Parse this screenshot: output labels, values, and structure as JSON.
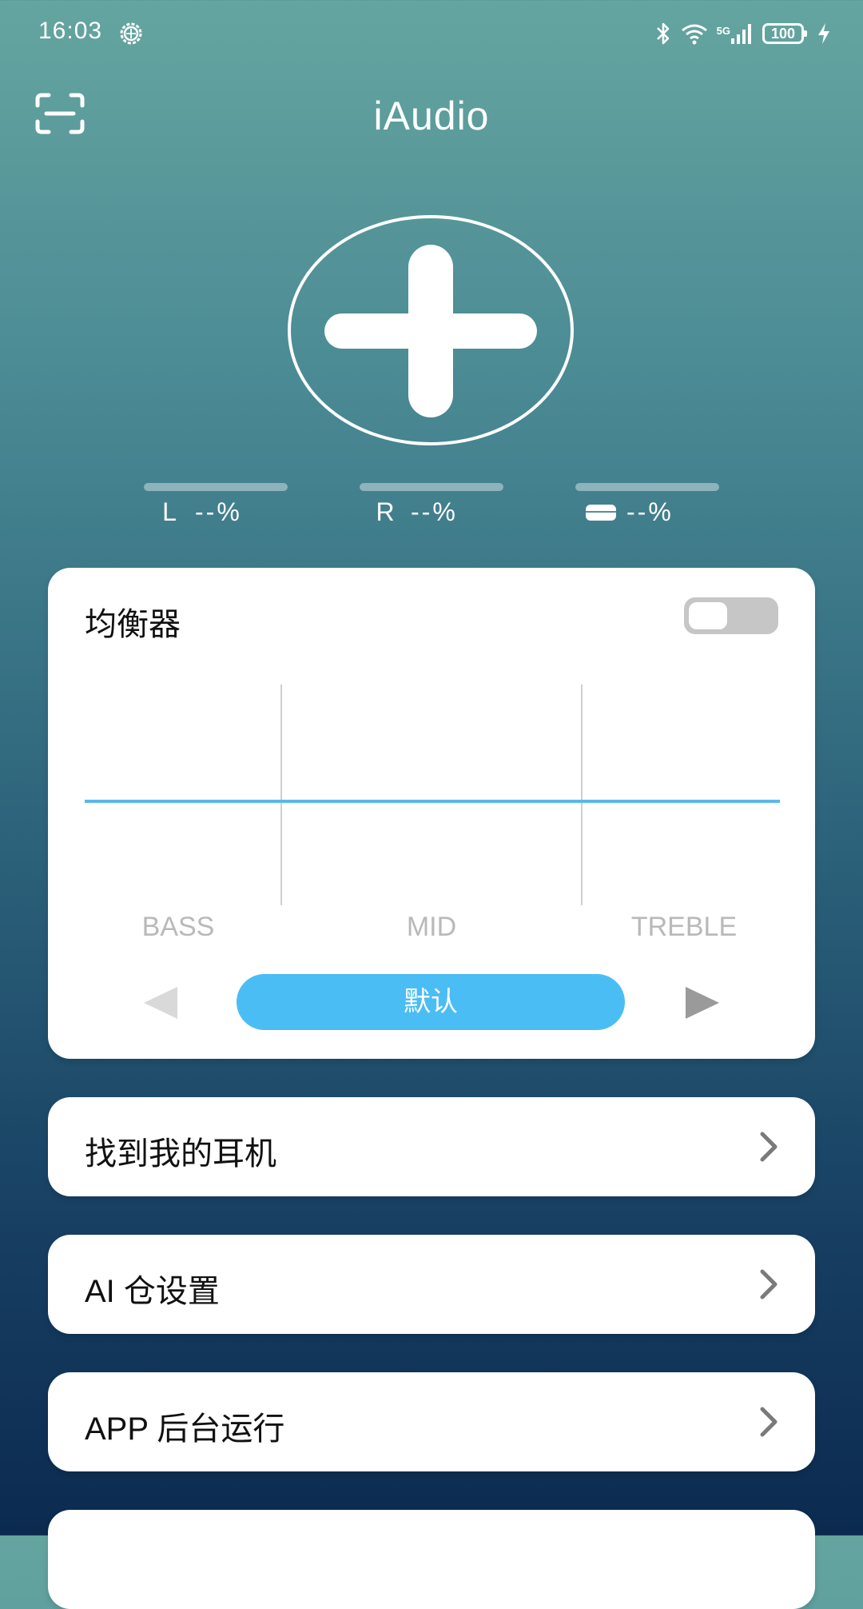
{
  "status_bar": {
    "time": "16:03",
    "network": "5G",
    "battery": "100",
    "icons": [
      "gear-icon",
      "bluetooth-icon",
      "wifi-icon",
      "signal-icon",
      "battery-icon",
      "charging-icon"
    ]
  },
  "header": {
    "title": "iAudio",
    "scan_icon": "scan-icon"
  },
  "device": {
    "add_icon": "add-device-icon"
  },
  "levels": [
    {
      "label": "L",
      "value": "--%"
    },
    {
      "label": "R",
      "value": "--%"
    },
    {
      "icon": "charging-case-icon",
      "value": "--%"
    }
  ],
  "equalizer": {
    "title": "均衡器",
    "enabled": false,
    "bands": [
      "BASS",
      "MID",
      "TREBLE"
    ],
    "preset": "默认",
    "curve_color": "#5bb8e8",
    "accent": "#4bbdf5"
  },
  "menu": [
    {
      "label": "找到我的耳机"
    },
    {
      "label": "AI 仓设置"
    },
    {
      "label": "APP 后台运行"
    }
  ]
}
